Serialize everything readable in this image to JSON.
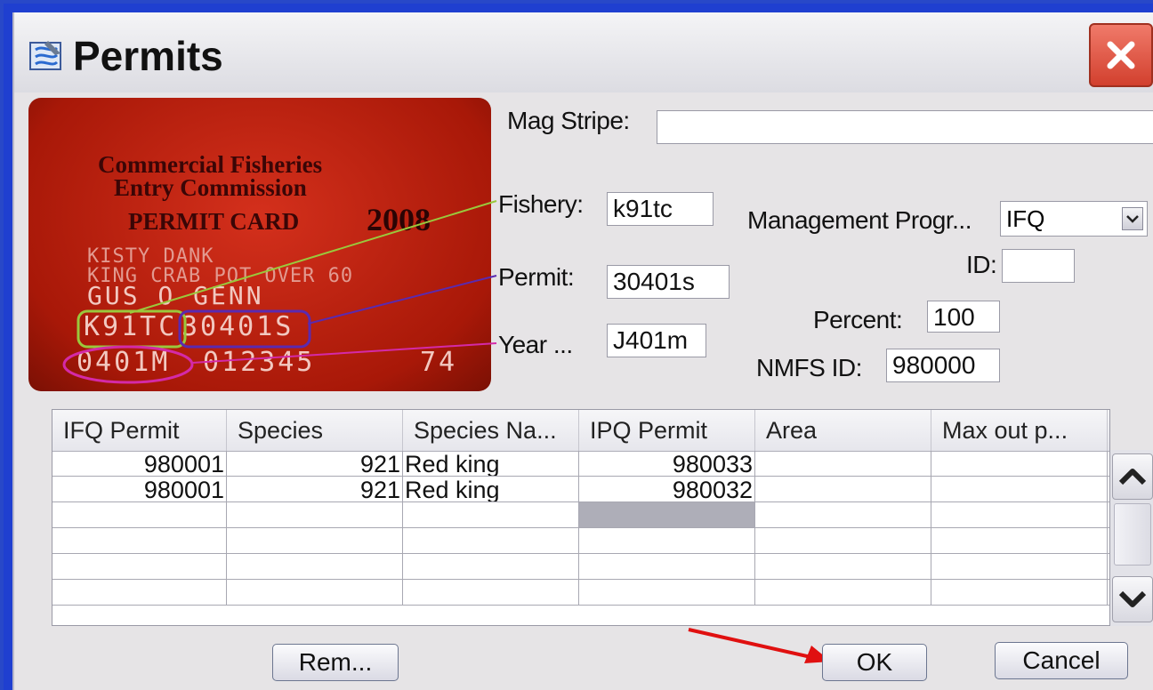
{
  "window": {
    "title": "Permits"
  },
  "card": {
    "line1": "Commercial Fisheries",
    "line2": "Entry Commission",
    "line3": "PERMIT CARD",
    "year": "2008",
    "faint1": "KISTY DANK",
    "faint2": "KING CRAB POT OVER 60",
    "holder": "GUS O GENN",
    "fishery_code": "K91TC",
    "permit_code": "30401S",
    "year_code": "0401M",
    "number": "012345",
    "suffix": "74"
  },
  "form": {
    "mag_stripe": {
      "label": "Mag Stripe:",
      "value": ""
    },
    "fishery": {
      "label": "Fishery:",
      "value": "k91tc"
    },
    "permit": {
      "label": "Permit:",
      "value": "30401s"
    },
    "year": {
      "label": "Year ...",
      "value": "J401m"
    },
    "management_program": {
      "label": "Management Progr...",
      "value": "IFQ"
    },
    "id": {
      "label": "ID:",
      "value": ""
    },
    "percent": {
      "label": "Percent:",
      "value": "100"
    },
    "nmfs_id": {
      "label": "NMFS ID:",
      "value": "980000"
    }
  },
  "table": {
    "columns": [
      "IFQ Permit",
      "Species",
      "Species Na...",
      "IPQ Permit",
      "Area",
      "Max out p..."
    ],
    "rows": [
      [
        "980001",
        "921",
        "Red king",
        "980033",
        "",
        ""
      ],
      [
        "980001",
        "921",
        "Red king",
        "980032",
        "",
        ""
      ],
      [
        "",
        "",
        "",
        "",
        "",
        ""
      ],
      [
        "",
        "",
        "",
        "",
        "",
        ""
      ],
      [
        "",
        "",
        "",
        "",
        "",
        ""
      ],
      [
        "",
        "",
        "",
        "",
        "",
        ""
      ]
    ]
  },
  "buttons": {
    "remove": "Rem...",
    "ok": "OK",
    "cancel": "Cancel"
  },
  "icons": {
    "app": "permits-app-icon",
    "close": "close-icon",
    "dropdown": "chevron-down-icon",
    "scroll_up": "chevron-up-icon",
    "scroll_down": "chevron-down-icon"
  },
  "colors": {
    "frame": "#1f3fd0",
    "card": "#b81e0a",
    "close": "#d94a36",
    "annot_fishery": "#9ac83c",
    "annot_permit": "#5a2ab0",
    "annot_year": "#d42aa8",
    "arrow": "#e01010"
  }
}
